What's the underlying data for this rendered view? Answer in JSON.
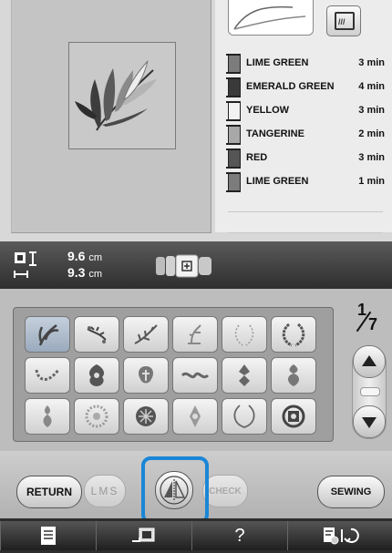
{
  "colors": [
    {
      "name": "LIME GREEN",
      "time": "3 min",
      "swatch": "#7c7c7c"
    },
    {
      "name": "EMERALD GREEN",
      "time": "4 min",
      "swatch": "#3a3a3a"
    },
    {
      "name": "YELLOW",
      "time": "3 min",
      "swatch": "#f2f2f2"
    },
    {
      "name": "TANGERINE",
      "time": "2 min",
      "swatch": "#a8a8a8"
    },
    {
      "name": "RED",
      "time": "3 min",
      "swatch": "#555555"
    },
    {
      "name": "LIME GREEN",
      "time": "1 min",
      "swatch": "#7c7c7c"
    }
  ],
  "size": {
    "height": "9.6",
    "width": "9.3",
    "unit": "cm"
  },
  "page": {
    "current": "1",
    "total": "7"
  },
  "buttons": {
    "return": "RETURN",
    "lms": "LMS",
    "check": "CHECK",
    "sewing": "SEWING",
    "help": "?"
  },
  "icons": {
    "view": "magnify-view-icon",
    "size": "size-arrows-icon",
    "hoop": "embroidery-frame-icon",
    "up": "up-arrow-icon",
    "down": "down-arrow-icon",
    "mirror": "mirror-image-icon",
    "page": "page-icon",
    "presser": "presser-foot-icon",
    "settings": "settings-icon"
  },
  "accent": "#1b86d6"
}
